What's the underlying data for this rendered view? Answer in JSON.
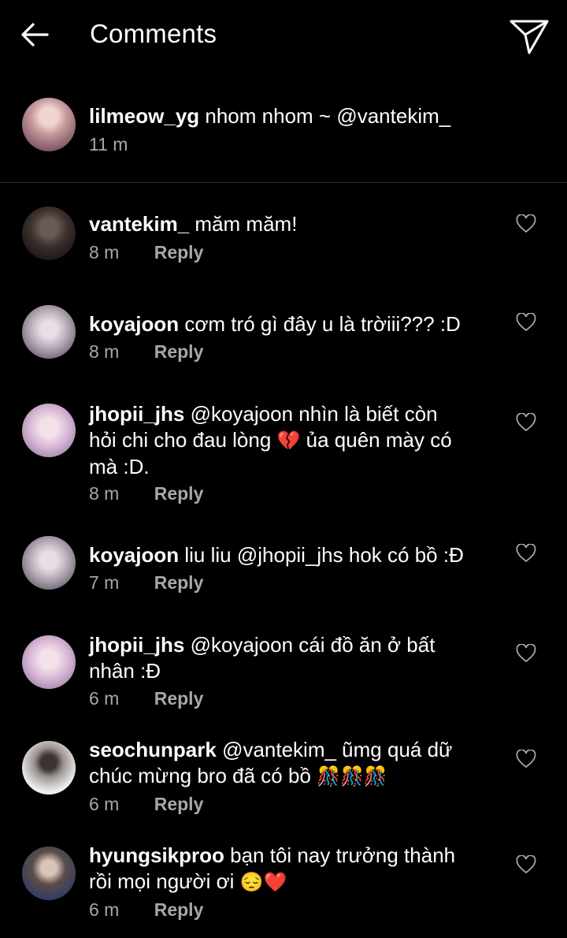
{
  "header": {
    "title": "Comments",
    "back_icon": "arrow-left-icon",
    "send_icon": "paper-plane-icon"
  },
  "caption": {
    "username": "lilmeow_yg",
    "text": "nhom nhom ~ @vantekim_",
    "time": "11 m"
  },
  "reply_label": "Reply",
  "comments": [
    {
      "username": "vantekim_",
      "text": "măm măm!",
      "time": "8 m"
    },
    {
      "username": "koyajoon",
      "text": "cơm tró gì đây u là trờiii??? :D",
      "time": "8 m"
    },
    {
      "username": "jhopii_jhs",
      "text_line1": "@koyajoon nhìn là biết còn",
      "text_line2": "hỏi chi cho đau lòng",
      "emoji": "💔",
      "text_line2b": "ủa quên mày có",
      "text_line3": "mà :D.",
      "time": "8 m"
    },
    {
      "username": "koyajoon",
      "text": "liu liu @jhopii_jhs hok có bồ :Đ",
      "time": "7 m"
    },
    {
      "username": "jhopii_jhs",
      "text_line1": "@koyajoon cái đồ ăn ở bất",
      "text_line2": "nhân :Đ",
      "time": "6 m"
    },
    {
      "username": "seochunpark",
      "text_line1": "@vantekim_ ũmg quá dữ",
      "text_line2": "chúc mừng bro đã có bồ",
      "emoji": "🎊🎊🎊",
      "time": "6 m"
    },
    {
      "username": "hyungsikproo",
      "text_line1": "bạn tôi nay trưởng thành",
      "text_line2": "rồi mọi người ơi",
      "emoji": "😔❤️",
      "time": "6 m"
    }
  ]
}
